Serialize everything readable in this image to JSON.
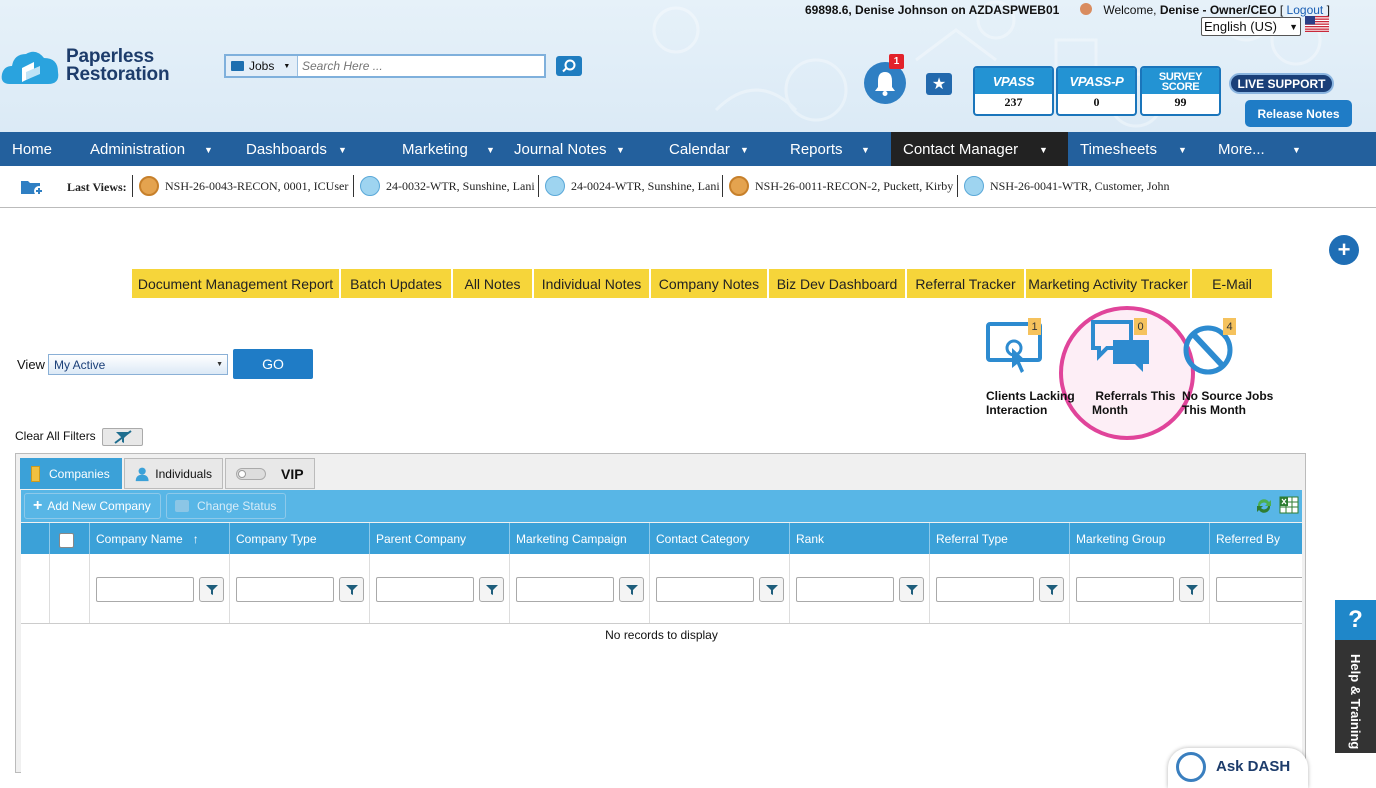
{
  "header": {
    "brand": [
      "Paperless",
      "Restoration"
    ],
    "session_info": "69898.6, Denise Johnson on AZDASPWEB01",
    "welcome_prefix": "Welcome,",
    "welcome_user": "Denise - Owner/CEO",
    "logout_label": "Logout",
    "language": "English (US)",
    "search": {
      "category": "Jobs",
      "placeholder": "Search Here ..."
    },
    "notifications_count": "1",
    "scores": [
      {
        "title": "VPASS",
        "value": "237"
      },
      {
        "title": "VPASS-P",
        "value": "0"
      },
      {
        "title": "SURVEY SCORE",
        "value": "99"
      }
    ],
    "live_support": "LIVE SUPPORT",
    "release_notes": "Release Notes"
  },
  "nav": [
    {
      "label": "Home",
      "caret": false
    },
    {
      "label": "Administration",
      "caret": true
    },
    {
      "label": "Dashboards",
      "caret": true
    },
    {
      "label": "Marketing",
      "caret": true
    },
    {
      "label": "Journal Notes",
      "caret": true
    },
    {
      "label": "Calendar",
      "caret": true
    },
    {
      "label": "Reports",
      "caret": true
    },
    {
      "label": "Contact Manager",
      "caret": true,
      "active": true
    },
    {
      "label": "Timesheets",
      "caret": true
    },
    {
      "label": "More...",
      "caret": true
    }
  ],
  "last_views": {
    "label": "Last Views:",
    "items": [
      {
        "text": "NSH-26-0043-RECON, 0001, ICUser",
        "icon": "recon-icon"
      },
      {
        "text": "24-0032-WTR, Sunshine, Lani",
        "icon": "water-icon"
      },
      {
        "text": "24-0024-WTR, Sunshine, Lani",
        "icon": "water-icon"
      },
      {
        "text": "NSH-26-0011-RECON-2, Puckett, Kirby",
        "icon": "recon-icon"
      },
      {
        "text": "NSH-26-0041-WTR, Customer, John",
        "icon": "water-icon"
      }
    ]
  },
  "quick_tabs": [
    "Document Management Report",
    "Batch Updates",
    "All Notes",
    "Individual Notes",
    "Company Notes",
    "Biz Dev Dashboard",
    "Referral Tracker",
    "Marketing Activity Tracker",
    "E-Mail"
  ],
  "widgets": [
    {
      "count": "1",
      "label_lines": [
        "Clients Lacking",
        "Interaction"
      ]
    },
    {
      "count": "0",
      "label_lines": [
        "Referrals This",
        "Month"
      ]
    },
    {
      "count": "4",
      "label_lines": [
        "No Source Jobs",
        "This Month"
      ]
    }
  ],
  "view": {
    "label": "View",
    "selected": "My Active",
    "go": "GO"
  },
  "clear_filters": "Clear All Filters",
  "grid": {
    "tabs": [
      "Companies",
      "Individuals",
      "VIP"
    ],
    "toolbar": {
      "add": "Add New Company",
      "change_status": "Change Status"
    },
    "columns": [
      "Company Name",
      "Company Type",
      "Parent Company",
      "Marketing Campaign",
      "Contact Category",
      "Rank",
      "Referral Type",
      "Marketing Group",
      "Referred By"
    ],
    "sorted_column": "Company Name",
    "empty_message": "No records to display"
  },
  "help": {
    "question": "?",
    "label": "Help & Training",
    "ask": "Ask DASH"
  },
  "colors": {
    "nav_bg": "#23609d",
    "active_nav": "#222222",
    "quick_tab": "#f6d53a",
    "grid_header": "#3ba1d8",
    "highlight": "#e0449a"
  }
}
